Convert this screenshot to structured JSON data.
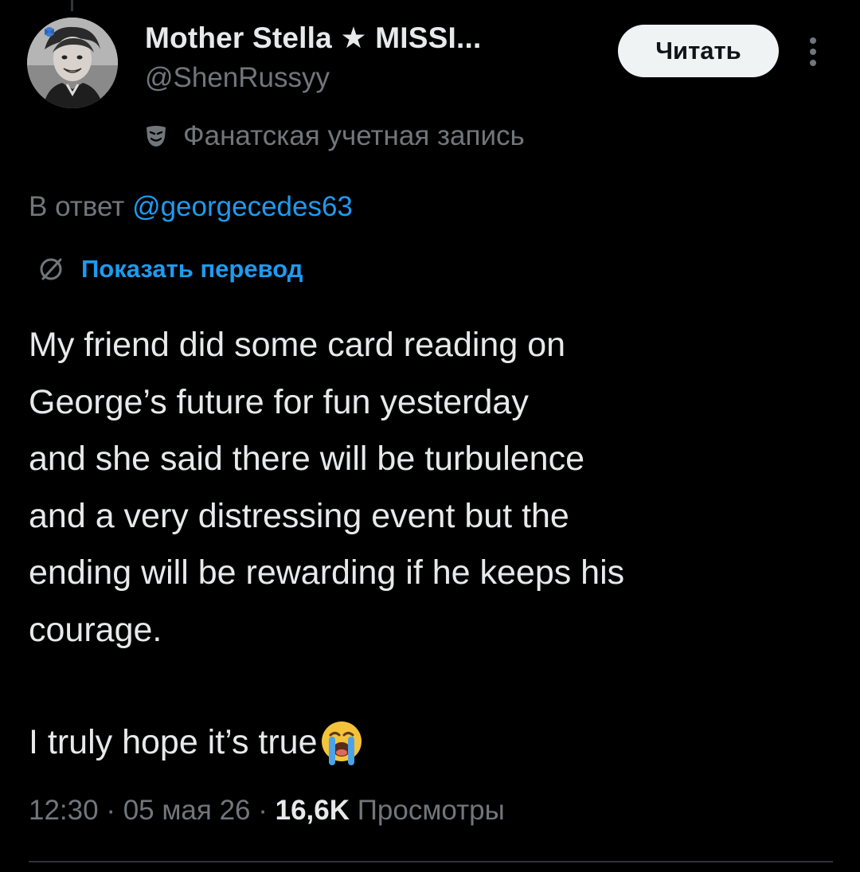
{
  "author": {
    "display_name": "Mother Stella ★ MISSI...",
    "handle": "@ShenRussyy",
    "badge": "Фанатская учетная запись"
  },
  "actions": {
    "follow_label": "Читать",
    "more_icon": "more-vertical-icon"
  },
  "reply": {
    "prefix": "В ответ ",
    "mention": "@georgecedes63"
  },
  "translate": {
    "label": "Показать перевод"
  },
  "tweet": {
    "lines": [
      "My friend did some card reading on",
      "George’s future for fun yesterday",
      "and she said there will be turbulence",
      "and a very distressing event but the",
      "ending will be rewarding if he keeps his",
      "courage."
    ],
    "last_line": "I truly hope it’s true",
    "emoji": "loudly-crying-face-icon"
  },
  "meta": {
    "time": "12:30",
    "sep1": " · ",
    "date": "05 мая 26",
    "sep2": " · ",
    "views_count": "16,6K",
    "views_label": " Просмотры"
  },
  "colors": {
    "background": "#000000",
    "text_primary": "#e7e9ea",
    "text_secondary": "#71767b",
    "accent": "#1d9bf0",
    "follow_bg": "#eff3f4"
  }
}
